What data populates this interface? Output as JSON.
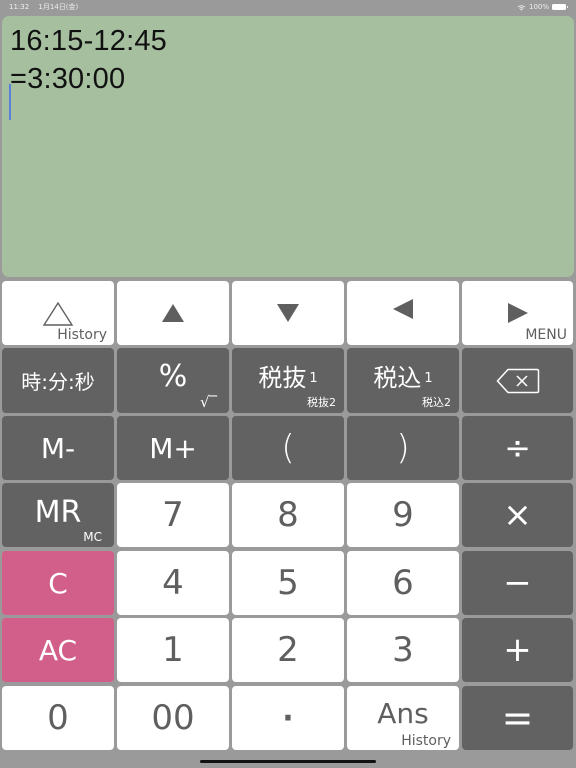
{
  "status_bar": {
    "time": "11:32",
    "date": "1月14日(金)",
    "battery": "100%"
  },
  "display": {
    "lines": [
      "16:15-12:45",
      "=3:30:00"
    ]
  },
  "keys": {
    "row1": [
      {
        "id": "history-up",
        "label": "△",
        "sub": "History"
      },
      {
        "id": "up",
        "label": "▲"
      },
      {
        "id": "down",
        "label": "▼"
      },
      {
        "id": "left",
        "label": "◀"
      },
      {
        "id": "right-menu",
        "label": "▶",
        "sub": "MENU"
      }
    ],
    "row2": [
      {
        "id": "time-format",
        "label": "時:分:秒"
      },
      {
        "id": "percent",
        "label": "%",
        "sub": "√‾‾"
      },
      {
        "id": "tax-excluded",
        "label": "税抜",
        "sup": "1",
        "sub": "税抜2"
      },
      {
        "id": "tax-included",
        "label": "税込",
        "sup": "1",
        "sub": "税込2"
      },
      {
        "id": "backspace",
        "label": "⌫"
      }
    ],
    "row3": [
      {
        "id": "m-minus",
        "label": "M-"
      },
      {
        "id": "m-plus",
        "label": "M+"
      },
      {
        "id": "paren-open",
        "label": "("
      },
      {
        "id": "paren-close",
        "label": ")"
      },
      {
        "id": "divide",
        "label": "÷"
      }
    ],
    "row4": [
      {
        "id": "mr",
        "label": "MR",
        "sub": "MC"
      },
      {
        "id": "7",
        "label": "7"
      },
      {
        "id": "8",
        "label": "8"
      },
      {
        "id": "9",
        "label": "9"
      },
      {
        "id": "multiply",
        "label": "×"
      }
    ],
    "row5": [
      {
        "id": "clear",
        "label": "C"
      },
      {
        "id": "4",
        "label": "4"
      },
      {
        "id": "5",
        "label": "5"
      },
      {
        "id": "6",
        "label": "6"
      },
      {
        "id": "minus",
        "label": "−"
      }
    ],
    "row6": [
      {
        "id": "all-clear",
        "label": "AC"
      },
      {
        "id": "1",
        "label": "1"
      },
      {
        "id": "2",
        "label": "2"
      },
      {
        "id": "3",
        "label": "3"
      },
      {
        "id": "plus",
        "label": "+"
      }
    ],
    "row7": [
      {
        "id": "0",
        "label": "0"
      },
      {
        "id": "00",
        "label": "00"
      },
      {
        "id": "decimal",
        "label": "·"
      },
      {
        "id": "ans",
        "label": "Ans",
        "sub": "History"
      },
      {
        "id": "equals",
        "label": "="
      }
    ]
  },
  "colors": {
    "display_bg": "#a5bf9f",
    "key_white": "#ffffff",
    "key_dark": "#626262",
    "key_pink": "#d25e8a",
    "background": "#9a9a9a"
  }
}
